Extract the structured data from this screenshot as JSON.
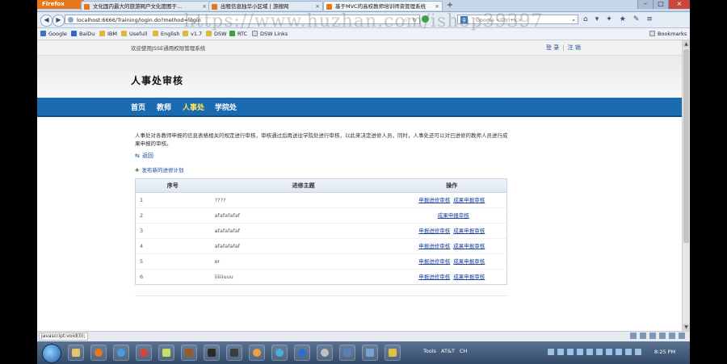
{
  "browser": {
    "app_button": "Firefox",
    "tabs": [
      {
        "label": "文化国内最大的旅游网户文化度图于..."
      },
      {
        "label": "出租信息独华小区域 | 游搜网"
      },
      {
        "label": "基于MVC的高校教师培训师资管理系统"
      }
    ],
    "url": "localhost:6666/Training/login.do?method=login",
    "search_placeholder": "Google <Ctrl+K>",
    "bookmarks": [
      "Google",
      "BaiDu",
      "IBM",
      "Usefull",
      "English",
      "v1.7",
      "DSW",
      "RTC",
      "DSW Links"
    ],
    "bookmarks_label": "Bookmarks"
  },
  "watermark": "https://www.huzhan.com/ishop39397",
  "page": {
    "welcome": "欢迎使用JSSE通用权限管理系统",
    "login": "登 录",
    "logout": "注 销",
    "title": "人事处审核",
    "nav": [
      {
        "label": "首页",
        "active": false
      },
      {
        "label": "教师",
        "active": false
      },
      {
        "label": "人事处",
        "active": true
      },
      {
        "label": "学院处",
        "active": false
      }
    ],
    "description": "人事处对各教师申报的信息表格相关的规定进行审核，审核通过后再送往学院处进行审核，以此来决定进修人员，同时，人事处还可以对已进修的教师人员进行成果申报的审核。",
    "back": "返回",
    "plan_link": "发布新的进修计划",
    "table": {
      "headers": [
        "序号",
        "进修主题",
        "操作"
      ],
      "rows": [
        {
          "index": "1",
          "topic": "????",
          "actions": [
            "申报进修审核",
            "成果申报审核"
          ]
        },
        {
          "index": "2",
          "topic": "afafafafaf",
          "actions": [
            "",
            "成果申报审核"
          ]
        },
        {
          "index": "3",
          "topic": "afafafafaf",
          "actions": [
            "申报进修审核",
            "成果申报审核"
          ]
        },
        {
          "index": "4",
          "topic": "afafafafaf",
          "actions": [
            "申报进修审核",
            "成果申报审核"
          ]
        },
        {
          "index": "5",
          "topic": "er",
          "actions": [
            "申报进修审核",
            "成果申报审核"
          ]
        },
        {
          "index": "6",
          "topic": "iiiiiiuuu",
          "actions": [
            "申报进修审核",
            "成果申报审核"
          ]
        }
      ]
    }
  },
  "status": "javascript:void(0);",
  "taskbar": {
    "tools": "Tools",
    "network": "AT&T",
    "ime": "CH",
    "time": "8:25 PM"
  }
}
